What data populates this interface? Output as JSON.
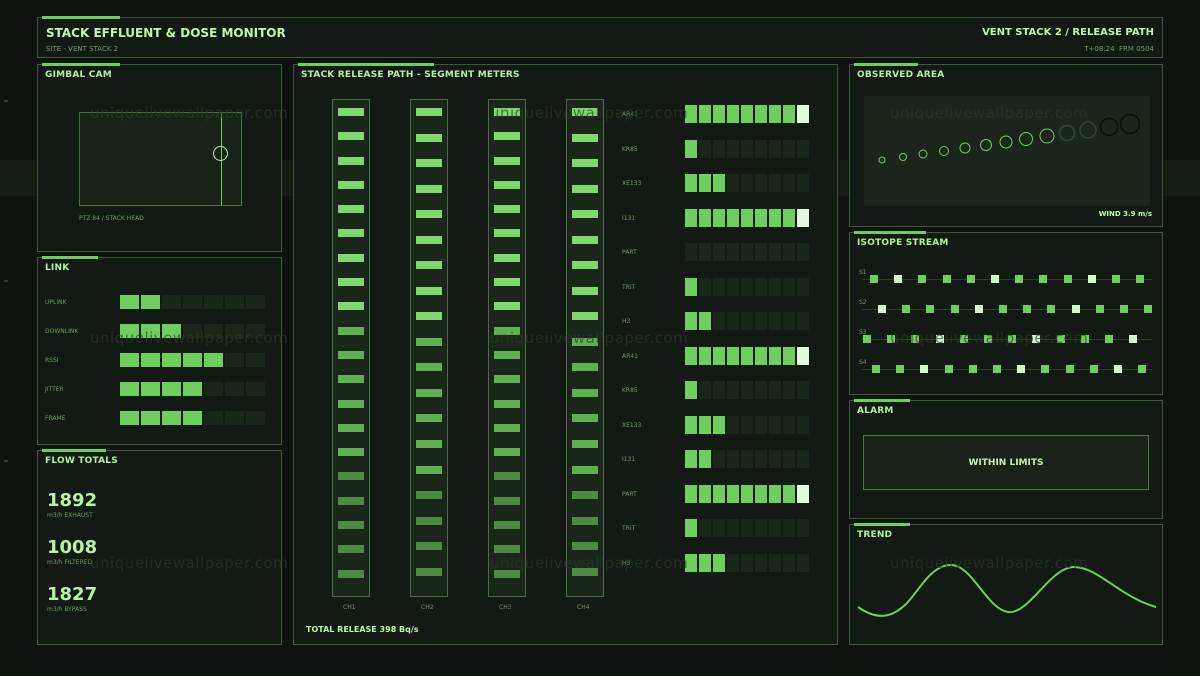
{
  "header": {
    "title": "STACK EFFLUENT & DOSE MONITOR",
    "site": "SITE - VENT STACK 2",
    "right_title": "VENT STACK 2 / RELEASE PATH",
    "time": "T+08:24",
    "frame": "FRM 0504"
  },
  "watermark": "uniquelivewallpaper.com",
  "gimbal": {
    "title": "GIMBAL CAM",
    "caption": "PTZ 84 / STACK HEAD"
  },
  "link": {
    "title": "LINK",
    "rows": [
      {
        "label": "UPLINK",
        "level": 0.29
      },
      {
        "label": "DOWNLINK",
        "level": 0.43
      },
      {
        "label": "RSSI",
        "level": 0.71
      },
      {
        "label": "JITTER",
        "level": 0.57
      },
      {
        "label": "FRAME",
        "level": 0.57
      }
    ]
  },
  "flow": {
    "title": "FLOW TOTALS",
    "items": [
      {
        "value": "1892",
        "label": "m3/h EXHAUST"
      },
      {
        "value": "1008",
        "label": "m3/h FILTERED"
      },
      {
        "value": "1827",
        "label": "m3/h BYPASS"
      }
    ]
  },
  "segment": {
    "title": "STACK RELEASE PATH - SEGMENT METERS",
    "channels": [
      "CH1",
      "CH2",
      "CH3",
      "CH4"
    ],
    "total": "TOTAL RELEASE 398 Bq/s",
    "isotopes": [
      {
        "label": "AR41",
        "level": 9
      },
      {
        "label": "KR85",
        "level": 1
      },
      {
        "label": "XE133",
        "level": 3
      },
      {
        "label": "I131",
        "level": 9
      },
      {
        "label": "PART",
        "level": 0
      },
      {
        "label": "TRIT",
        "level": 1
      },
      {
        "label": "H3",
        "level": 2
      },
      {
        "label": "AR41",
        "level": 9
      },
      {
        "label": "KR85",
        "level": 1
      },
      {
        "label": "XE133",
        "level": 3
      },
      {
        "label": "I131",
        "level": 2
      },
      {
        "label": "PART",
        "level": 9
      },
      {
        "label": "TRIT",
        "level": 1
      },
      {
        "label": "H3",
        "level": 3
      }
    ]
  },
  "observed": {
    "title": "OBSERVED AREA",
    "wind": "WIND 3.9 m/s"
  },
  "stream": {
    "title": "ISOTOPE STREAM",
    "rows": [
      "S1",
      "S2",
      "S3",
      "S4"
    ]
  },
  "alarm": {
    "title": "ALARM",
    "status": "WITHIN LIMITS"
  },
  "trend": {
    "title": "TREND"
  },
  "colors": {
    "accent": "#6fcf5e",
    "bright": "#e2f7dc",
    "dim": "#1b261b",
    "border": "#3c5a36"
  }
}
